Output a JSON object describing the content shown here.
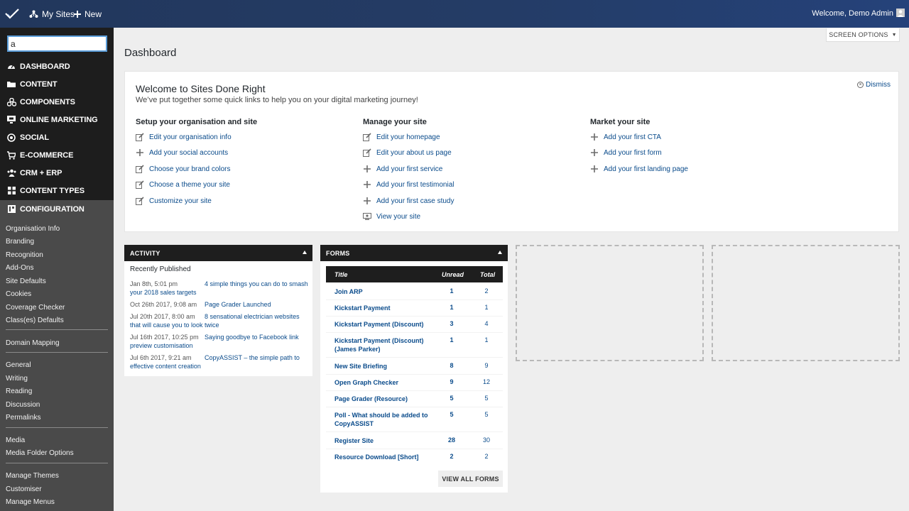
{
  "topbar": {
    "my_sites": "My Sites",
    "new": "New",
    "welcome": "Welcome, Demo Admin"
  },
  "sidebar": {
    "search_value": "a",
    "menu": [
      {
        "label": "DASHBOARD",
        "icon": "dashboard-icon"
      },
      {
        "label": "CONTENT",
        "icon": "folder-icon"
      },
      {
        "label": "COMPONENTS",
        "icon": "components-icon"
      },
      {
        "label": "ONLINE MARKETING",
        "icon": "monitor-icon"
      },
      {
        "label": "SOCIAL",
        "icon": "social-icon"
      },
      {
        "label": "E-COMMERCE",
        "icon": "cart-icon"
      },
      {
        "label": "CRM + ERP",
        "icon": "crm-icon"
      },
      {
        "label": "CONTENT TYPES",
        "icon": "grid-icon"
      },
      {
        "label": "CONFIGURATION",
        "icon": "configuration-icon"
      }
    ],
    "submenu": [
      "Organisation Info",
      "Branding",
      "Recognition",
      "Add-Ons",
      "Site Defaults",
      "Cookies",
      "Coverage Checker",
      "Class(es) Defaults",
      "Domain Mapping",
      "General",
      "Writing",
      "Reading",
      "Discussion",
      "Permalinks",
      "Media",
      "Media Folder Options",
      "Manage Themes",
      "Customiser",
      "Manage Menus"
    ]
  },
  "screen_options": "SCREEN OPTIONS",
  "page_title": "Dashboard",
  "welcome_panel": {
    "title": "Welcome to Sites Done Right",
    "subtitle": "We’ve put together some quick links to help you on your digital marketing journey!",
    "dismiss": "Dismiss",
    "columns": [
      {
        "heading": "Setup your organisation and site",
        "links": [
          {
            "label": "Edit your organisation info",
            "icon": "edit-icon"
          },
          {
            "label": "Add your social accounts",
            "icon": "plus-icon"
          },
          {
            "label": "Choose your brand colors",
            "icon": "edit-icon"
          },
          {
            "label": "Choose a theme your site",
            "icon": "edit-icon"
          },
          {
            "label": "Customize your site",
            "icon": "edit-icon"
          }
        ]
      },
      {
        "heading": "Manage your site",
        "links": [
          {
            "label": "Edit your homepage",
            "icon": "edit-icon"
          },
          {
            "label": "Edit your about us page",
            "icon": "edit-icon"
          },
          {
            "label": "Add your first service",
            "icon": "plus-icon"
          },
          {
            "label": "Add your first testimonial",
            "icon": "plus-icon"
          },
          {
            "label": "Add your first case study",
            "icon": "plus-icon"
          },
          {
            "label": "View your site",
            "icon": "view-icon"
          }
        ]
      },
      {
        "heading": "Market your site",
        "links": [
          {
            "label": "Add your first CTA",
            "icon": "plus-icon"
          },
          {
            "label": "Add your first form",
            "icon": "plus-icon"
          },
          {
            "label": "Add your first landing page",
            "icon": "plus-icon"
          }
        ]
      }
    ]
  },
  "activity": {
    "title": "ACTIVITY",
    "subtitle": "Recently Published",
    "items": [
      {
        "date": "Jan 8th, 5:01 pm",
        "title": "4 simple things you can do to smash your 2018 sales targets"
      },
      {
        "date": "Oct 26th 2017, 9:08 am",
        "title": "Page Grader Launched"
      },
      {
        "date": "Jul 20th 2017, 8:00 am",
        "title": "8 sensational electrician websites that will cause you to look twice"
      },
      {
        "date": "Jul 16th 2017, 10:25 pm",
        "title": "Saying goodbye to Facebook link preview customisation"
      },
      {
        "date": "Jul 6th 2017, 9:21 am",
        "title": "CopyASSIST – the simple path to effective content creation"
      }
    ]
  },
  "forms": {
    "title": "FORMS",
    "columns": {
      "title": "Title",
      "unread": "Unread",
      "total": "Total"
    },
    "rows": [
      {
        "title": "Join ARP",
        "unread": "1",
        "total": "2"
      },
      {
        "title": "Kickstart Payment",
        "unread": "1",
        "total": "1"
      },
      {
        "title": "Kickstart Payment (Discount)",
        "unread": "3",
        "total": "4"
      },
      {
        "title": "Kickstart Payment (Discount) (James Parker)",
        "unread": "1",
        "total": "1"
      },
      {
        "title": "New Site Briefing",
        "unread": "8",
        "total": "9"
      },
      {
        "title": "Open Graph Checker",
        "unread": "9",
        "total": "12"
      },
      {
        "title": "Page Grader (Resource)",
        "unread": "5",
        "total": "5"
      },
      {
        "title": "Poll - What should be added to CopyASSIST",
        "unread": "5",
        "total": "5"
      },
      {
        "title": "Register Site",
        "unread": "28",
        "total": "30"
      },
      {
        "title": "Resource Download [Short]",
        "unread": "2",
        "total": "2"
      }
    ],
    "view_all": "VIEW ALL FORMS"
  },
  "colors": {
    "topbar": "#243c66",
    "sidebar_dark": "#1d1d1d",
    "sidebar_sub": "#4a4a4a",
    "link": "#0a4b8b",
    "box_header": "#1e1e1e"
  }
}
